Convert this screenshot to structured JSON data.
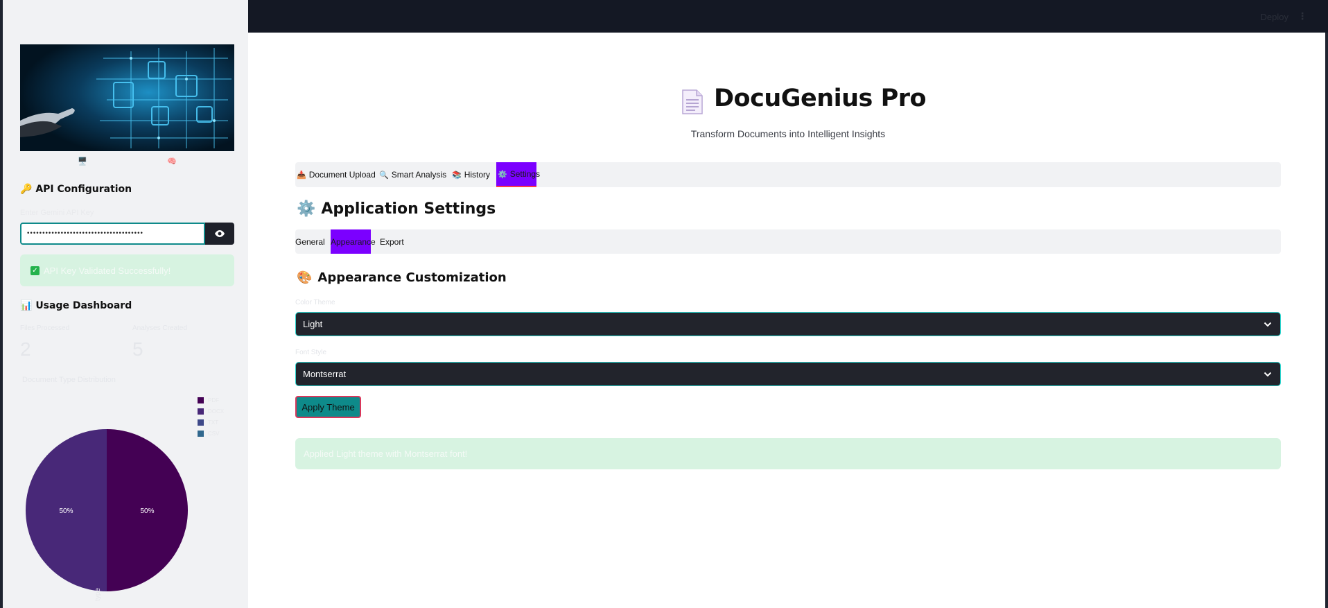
{
  "sidebar": {
    "image_alt": "AI document processing illustration",
    "mini_icons": [
      "🖥️",
      "🧠"
    ],
    "api_heading_icon": "🔑",
    "api_heading": "API Configuration",
    "api_key_label": "Enter Gemini API Key",
    "api_key_value": "••••••••••••••••••••••••••••••••••••••",
    "api_success": "API Key Validated Successfully!",
    "usage_heading_icon": "📊",
    "usage_heading": "Usage Dashboard",
    "metrics": [
      {
        "label": "Files Processed",
        "value": "2"
      },
      {
        "label": "Analyses Created",
        "value": "5"
      }
    ],
    "distribution_title": "Document Type Distribution",
    "legend": [
      {
        "name": "PDF",
        "color": "#440154"
      },
      {
        "name": "DOCX",
        "color": "#482878"
      },
      {
        "name": "TXT",
        "color": "#3e4989"
      },
      {
        "name": "CSV",
        "color": "#31688e"
      }
    ],
    "pie_footer": "type"
  },
  "chart_data": {
    "type": "pie",
    "title": "Document Type Distribution",
    "slices": [
      {
        "label": "50%",
        "value": 50,
        "color": "#440154"
      },
      {
        "label": "50%",
        "value": 50,
        "color": "#482878"
      }
    ],
    "legend_position": "top-right"
  },
  "topbar": {
    "deploy_label": "Deploy",
    "menu_icon": "⋮"
  },
  "app": {
    "logo_icon": "document-icon",
    "title": "DocuGenius Pro",
    "subtitle": "Transform Documents into Intelligent Insights"
  },
  "tabs": [
    {
      "icon": "📥",
      "label": "Document Upload"
    },
    {
      "icon": "🔍",
      "label": "Smart Analysis"
    },
    {
      "icon": "📚",
      "label": "History"
    },
    {
      "icon": "⚙️",
      "label": "Settings"
    }
  ],
  "settings": {
    "heading_icon": "⚙️",
    "heading": "Application Settings",
    "subtabs": [
      "General",
      "Appearance",
      "Export"
    ],
    "appearance_icon": "🎨",
    "appearance_heading": "Appearance Customization",
    "theme_label": "Color Theme",
    "theme_value": "Light",
    "font_label": "Font Style",
    "font_value": "Montserrat",
    "apply_label": "Apply Theme",
    "success_msg": "Applied Light theme with Montserrat font!"
  },
  "colors": {
    "accent_active": "#7b00ff",
    "teal": "#0e8a8a",
    "success_bg": "#d7f3e1"
  }
}
